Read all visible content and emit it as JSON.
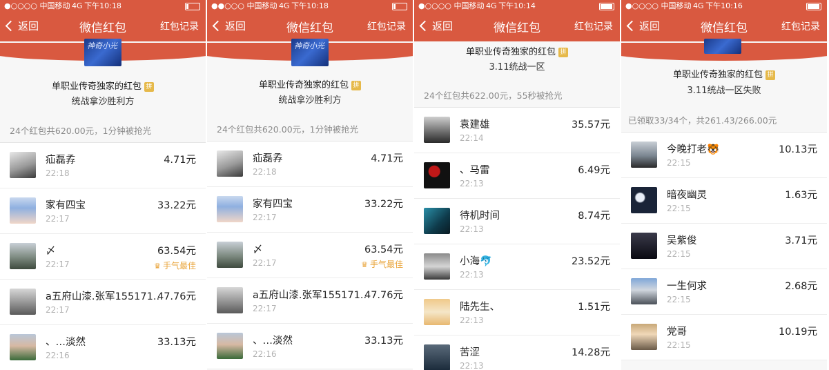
{
  "screens": [
    {
      "status": {
        "signal": "●○○○○ 中国移动",
        "network": "4G",
        "time": "下午10:18"
      },
      "nav": {
        "back": "返回",
        "title": "微信红包",
        "records": "红包记录"
      },
      "sender": "单职业传奇独家的红包",
      "pin": "拼",
      "wish": "统战拿沙胜利方",
      "summary": "24个红包共620.00元，1分钟被抢光",
      "avatar_text": "神奇小光",
      "items": [
        {
          "name": "疝磊孨",
          "time": "22:18",
          "amount": "4.71元",
          "best": ""
        },
        {
          "name": "家有四宝",
          "time": "22:17",
          "amount": "33.22元",
          "best": ""
        },
        {
          "name": "〆",
          "time": "22:17",
          "amount": "63.54元",
          "best": "手气最佳"
        },
        {
          "name": "a五府山漆.张军155171...",
          "time": "22:17",
          "amount": "47.76元",
          "best": ""
        },
        {
          "name": "、…淡然",
          "time": "22:16",
          "amount": "33.13元",
          "best": ""
        }
      ]
    },
    {
      "status": {
        "signal": "●●○○○ 中国移动",
        "network": "4G",
        "time": "下午10:18"
      },
      "nav": {
        "back": "返回",
        "title": "微信红包",
        "records": "红包记录"
      },
      "sender": "单职业传奇独家的红包",
      "pin": "拼",
      "wish": "统战拿沙胜利方",
      "summary": "24个红包共620.00元，1分钟被抢光",
      "avatar_text": "神奇小光",
      "items": [
        {
          "name": "疝磊孨",
          "time": "22:18",
          "amount": "4.71元",
          "best": ""
        },
        {
          "name": "家有四宝",
          "time": "22:17",
          "amount": "33.22元",
          "best": ""
        },
        {
          "name": "〆",
          "time": "22:17",
          "amount": "63.54元",
          "best": "手气最佳"
        },
        {
          "name": "a五府山漆.张军155171...",
          "time": "22:17",
          "amount": "47.76元",
          "best": ""
        },
        {
          "name": "、…淡然",
          "time": "22:16",
          "amount": "33.13元",
          "best": ""
        }
      ]
    },
    {
      "status": {
        "signal": "●○○○○ 中国移动",
        "network": "4G",
        "time": "下午10:14"
      },
      "nav": {
        "back": "返回",
        "title": "微信红包",
        "records": "红包记录"
      },
      "sender": "单职业传奇独家的红包",
      "pin": "拼",
      "wish": "3.11统战一区",
      "summary": "24个红包共622.00元，55秒被抢光",
      "avatar_text": "",
      "items": [
        {
          "name": "袁建雄",
          "time": "22:14",
          "amount": "35.57元",
          "best": ""
        },
        {
          "name": "、马雷",
          "time": "22:13",
          "amount": "6.49元",
          "best": ""
        },
        {
          "name": "待机时间",
          "time": "22:13",
          "amount": "8.74元",
          "best": ""
        },
        {
          "name": "小海🐬",
          "time": "22:13",
          "amount": "23.52元",
          "best": ""
        },
        {
          "name": "陆先生、",
          "time": "22:13",
          "amount": "1.51元",
          "best": ""
        },
        {
          "name": "苦涩",
          "time": "22:13",
          "amount": "14.28元",
          "best": ""
        }
      ]
    },
    {
      "status": {
        "signal": "●○○○○ 中国移动",
        "network": "4G",
        "time": "下午10:16"
      },
      "nav": {
        "back": "返回",
        "title": "微信红包",
        "records": "红包记录"
      },
      "sender": "单职业传奇独家的红包",
      "pin": "拼",
      "wish": "3.11统战一区失败",
      "summary": "已领取33/34个，共261.43/266.00元",
      "avatar_text": "",
      "items": [
        {
          "name": "今晚打老🐯",
          "time": "22:15",
          "amount": "10.13元",
          "best": ""
        },
        {
          "name": "暗夜幽灵",
          "time": "22:15",
          "amount": "1.63元",
          "best": ""
        },
        {
          "name": "吴紫俊",
          "time": "22:15",
          "amount": "3.71元",
          "best": ""
        },
        {
          "name": "一生何求",
          "time": "22:15",
          "amount": "2.68元",
          "best": ""
        },
        {
          "name": "党哥",
          "time": "22:15",
          "amount": "10.19元",
          "best": ""
        }
      ]
    }
  ],
  "colors": {
    "brand": "#d95940",
    "best": "#e9a43a",
    "gold_pin": "#e6b94a"
  }
}
